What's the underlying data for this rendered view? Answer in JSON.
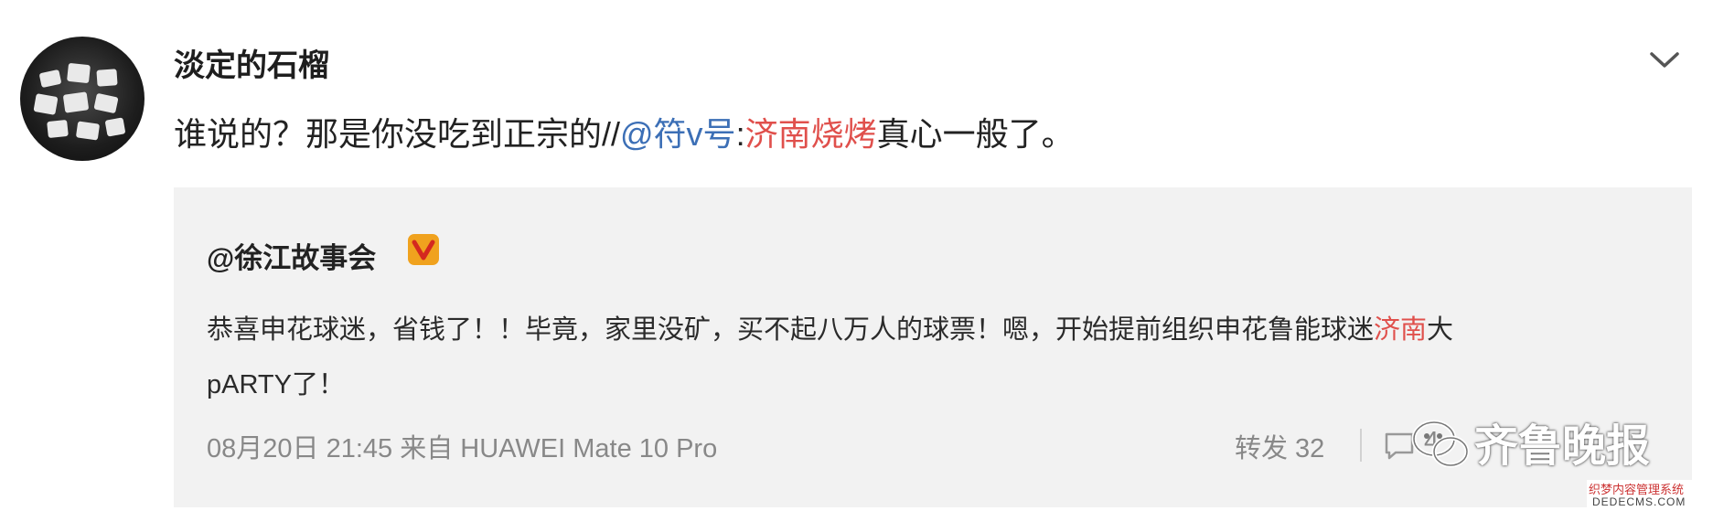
{
  "post": {
    "username": "淡定的石榴",
    "text": {
      "prefix": "谁说的？那是你没吃到正宗的//",
      "mention": "@符v号",
      "colon": ":",
      "highlight": "济南烧烤",
      "suffix": "真心一般了。"
    },
    "menu_icon": "chevron-down-icon",
    "repost": {
      "author": "@徐江故事会",
      "verified_icon": "verified-v-icon",
      "line1_before": "恭喜申花球迷，省钱了！！毕竟，家里没矿，买不起八万人的球票！嗯，开始提前组织申花鲁能球迷",
      "line1_highlight": "济南",
      "line1_after": "大",
      "line2": "pARTY了！",
      "meta": "08月20日 21:45 来自 HUAWEI Mate 10 Pro",
      "repost_label": "转发 32",
      "comment_count_partial": "4"
    }
  },
  "watermark": {
    "text": "齐鲁晚报",
    "icon": "wechat-icon"
  },
  "site_watermark": {
    "cn": "织梦内容管理系统",
    "en": "DEDECMS.COM"
  },
  "colors": {
    "mention": "#3c6fb6",
    "highlight": "#e0504c",
    "repost_background": "#f2f2f2",
    "meta_text": "#888888"
  }
}
